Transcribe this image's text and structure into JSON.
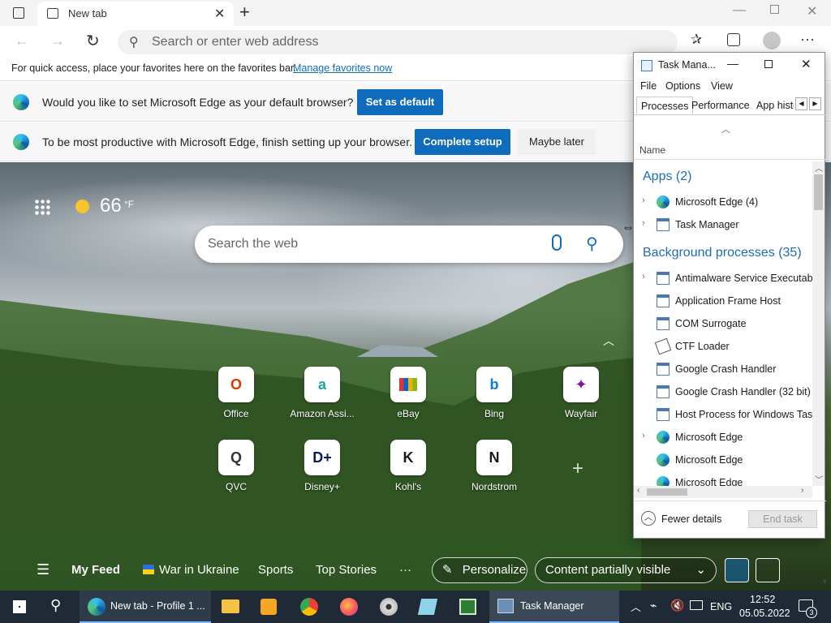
{
  "browser": {
    "tab_title": "New tab",
    "address_placeholder": "Search or enter web address",
    "favorites_text": "For quick access, place your favorites here on the favorites bar.",
    "favorites_link": "Manage favorites now"
  },
  "banners": {
    "default_text": "Would you like to set Microsoft Edge as your default browser?",
    "default_button": "Set as default",
    "setup_text": "To be most productive with Microsoft Edge, finish setting up your browser.",
    "setup_button": "Complete setup",
    "later_button": "Maybe later"
  },
  "ntp": {
    "temperature": "66",
    "temp_unit": "°F",
    "search_placeholder": "Search the web",
    "shortcuts": [
      {
        "name": "Office",
        "letter": "O",
        "color": "#d83b01"
      },
      {
        "name": "Amazon Assi...",
        "letter": "a",
        "color": "#1aa79b"
      },
      {
        "name": "eBay",
        "letter": "",
        "color": "#e53238"
      },
      {
        "name": "Bing",
        "letter": "b",
        "color": "#0a7bd6"
      },
      {
        "name": "Wayfair",
        "letter": "✦",
        "color": "#7b189f"
      },
      {
        "name": "QVC",
        "letter": "Q",
        "color": "#333333"
      },
      {
        "name": "Disney+",
        "letter": "D+",
        "color": "#0b1a5a"
      },
      {
        "name": "Kohl's",
        "letter": "K",
        "color": "#1a1a1a"
      },
      {
        "name": "Nordstrom",
        "letter": "N",
        "color": "#1a1a1a"
      }
    ],
    "feed": {
      "my_feed": "My Feed",
      "ukraine": "War in Ukraine",
      "sports": "Sports",
      "top_stories": "Top Stories",
      "more": "···",
      "personalize": "Personalize",
      "content": "Content partially visible"
    }
  },
  "taskmanager": {
    "title": "Task Mana...",
    "menu": [
      "File",
      "Options",
      "View"
    ],
    "tabs": [
      "Processes",
      "Performance",
      "App histo"
    ],
    "column_name": "Name",
    "apps_group": "Apps (2)",
    "apps": [
      {
        "label": "Microsoft Edge (4)",
        "icon": "edge-icon",
        "expand": true
      },
      {
        "label": "Task Manager",
        "icon": "taskmgr-icon",
        "expand": true
      }
    ],
    "bg_group": "Background processes (35)",
    "background": [
      {
        "label": "Antimalware Service Executable",
        "icon": "service-icon",
        "expand": true
      },
      {
        "label": "Application Frame Host",
        "icon": "service-icon",
        "expand": false
      },
      {
        "label": "COM Surrogate",
        "icon": "service-icon",
        "expand": false
      },
      {
        "label": "CTF Loader",
        "icon": "ctf-icon",
        "expand": false
      },
      {
        "label": "Google Crash Handler",
        "icon": "service-icon",
        "expand": false
      },
      {
        "label": "Google Crash Handler (32 bit)",
        "icon": "service-icon",
        "expand": false
      },
      {
        "label": "Host Process for Windows Tasks",
        "icon": "service-icon",
        "expand": false
      },
      {
        "label": "Microsoft Edge",
        "icon": "edge-icon",
        "expand": true
      },
      {
        "label": "Microsoft Edge",
        "icon": "edge-icon",
        "expand": false
      },
      {
        "label": "Microsoft Edge",
        "icon": "edge-icon",
        "expand": false
      }
    ],
    "fewer_details": "Fewer details",
    "end_task": "End task"
  },
  "taskbar": {
    "edge_label": "New tab - Profile 1 ...",
    "taskmgr_label": "Task Manager",
    "lang": "ENG",
    "time": "12:52",
    "date": "05.05.2022",
    "notifications": "3"
  },
  "colors": {
    "accent": "#0f6cbd",
    "taskbar": "#1f2a36",
    "tm_group": "#1e6bb8"
  }
}
